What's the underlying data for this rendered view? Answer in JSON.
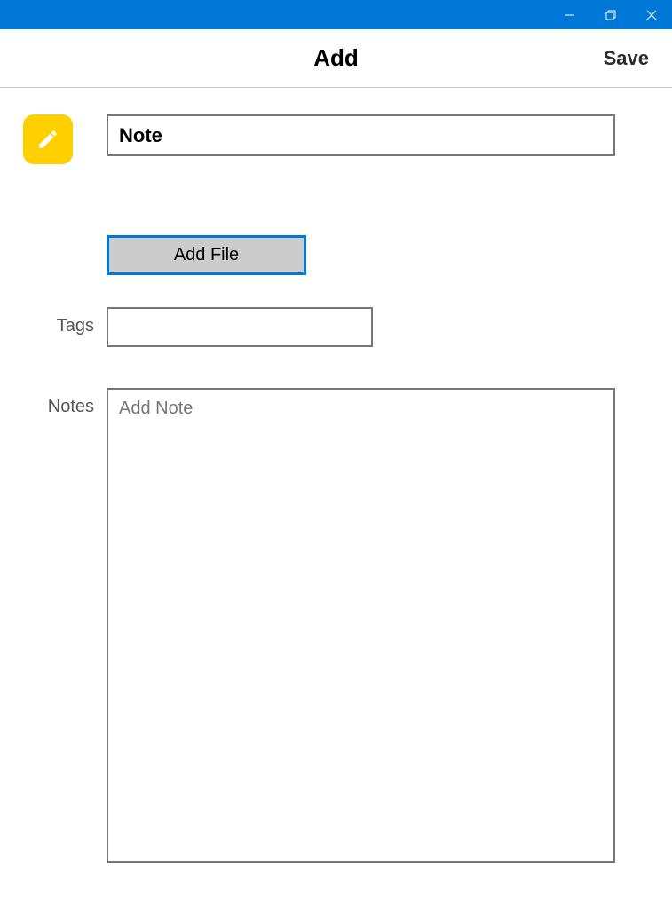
{
  "window": {
    "minimize": "Minimize",
    "maximize": "Maximize",
    "close": "Close"
  },
  "header": {
    "title": "Add",
    "save": "Save"
  },
  "form": {
    "title_value": "Note",
    "add_file_label": "Add File",
    "tags_label": "Tags",
    "tags_value": "",
    "notes_label": "Notes",
    "notes_value": "",
    "notes_placeholder": "Add Note"
  },
  "icons": {
    "note": "pencil-icon"
  },
  "colors": {
    "accent": "#0078d7",
    "icon_bg": "#ffcf00"
  }
}
